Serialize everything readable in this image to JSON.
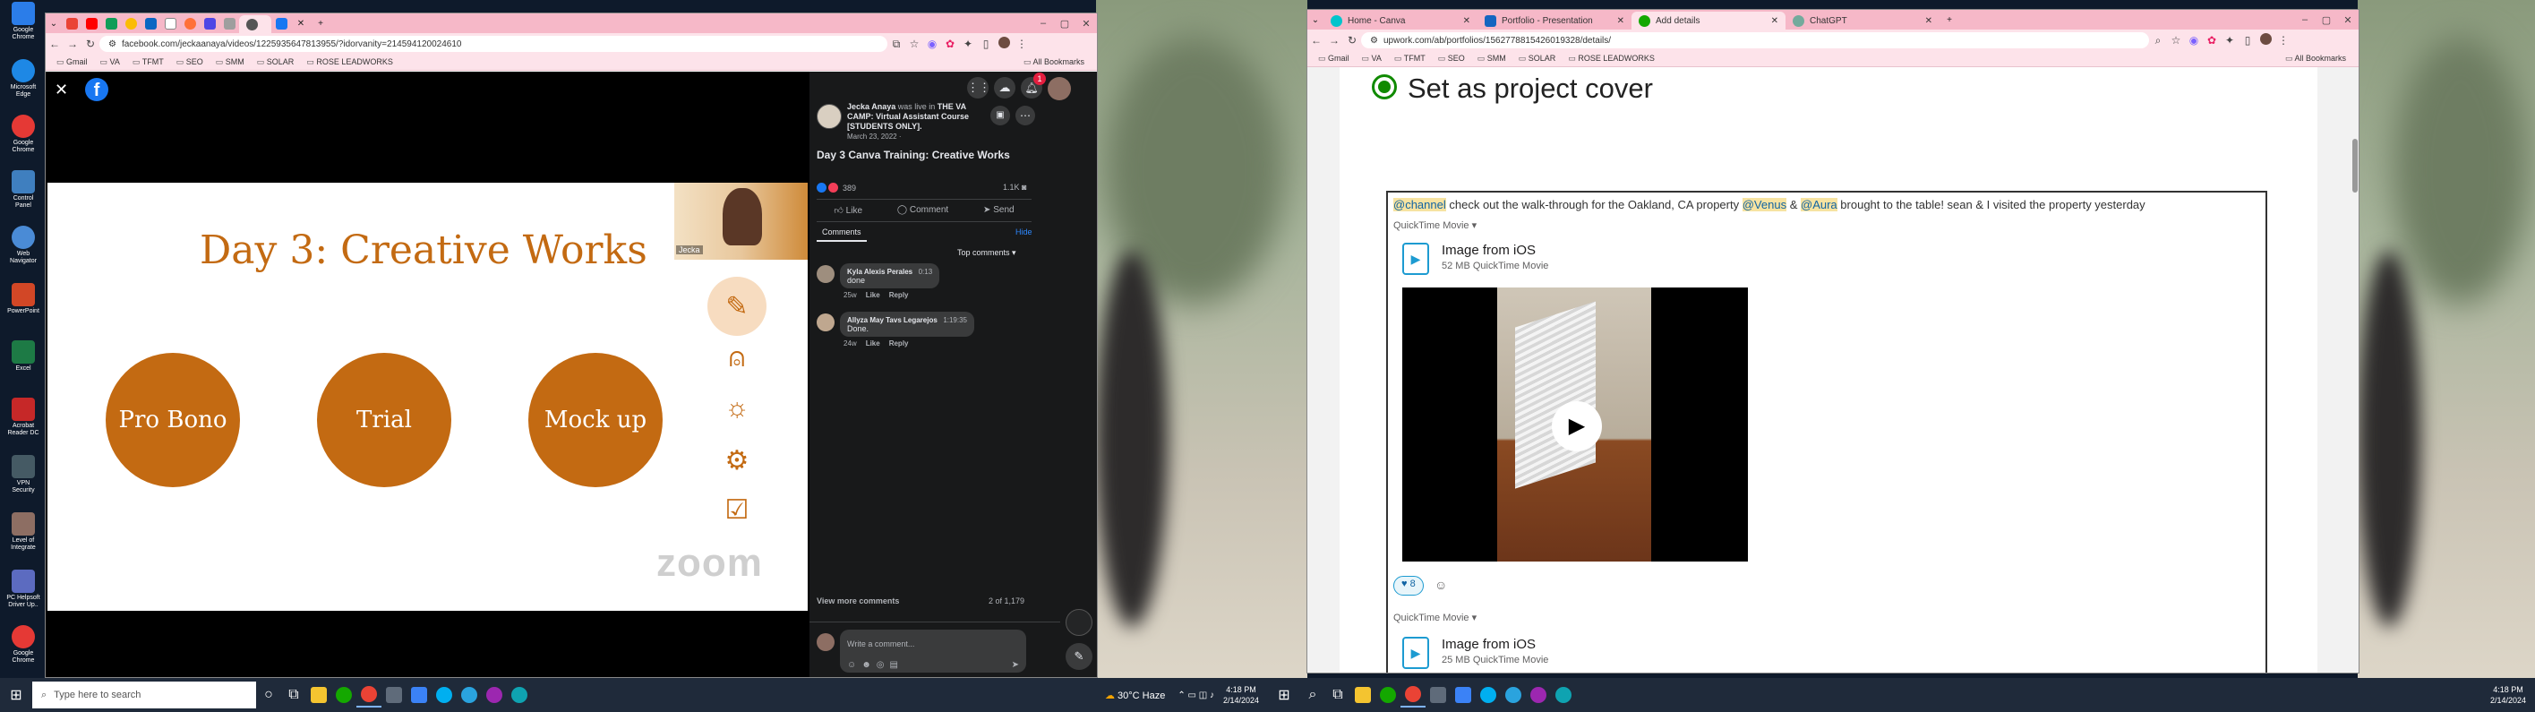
{
  "left_browser": {
    "tabs": [
      "Gmail",
      "YouTube",
      "Sheets",
      "Chrome",
      "LinkedIn",
      "Page",
      "Firefox",
      "Flipboard",
      "Tab",
      "Sound",
      "Facebook"
    ],
    "url": "facebook.com/jeckaanaya/videos/1225935647813955/?idorvanity=214594120024610",
    "bookmarks": [
      "Gmail",
      "VA",
      "TFMT",
      "SEO",
      "SMM",
      "SOLAR",
      "ROSE LEADWORKS"
    ],
    "all_bookmarks": "All Bookmarks"
  },
  "slide": {
    "title": "Day 3: Creative Works",
    "circles": [
      "Pro Bono",
      "Trial",
      "Mock up"
    ],
    "watermark": "zoom",
    "presenter_label": "Jecka"
  },
  "post": {
    "author": "Jecka Anaya",
    "live_text": "was live in",
    "group": "THE VA CAMP: Virtual Assistant Course [STUDENTS ONLY].",
    "date": "March 23, 2022 ·",
    "title": "Day 3 Canva Training: Creative Works",
    "reactions": "389",
    "views": "1.1K",
    "actions": [
      "Like",
      "Comment",
      "Send"
    ],
    "tab_comments": "Comments",
    "hide": "Hide",
    "sort": "Top comments",
    "comments": [
      {
        "name": "Kyla Alexis Perales",
        "time": "0:13",
        "text": "done",
        "age": "25w",
        "like": "Like",
        "reply": "Reply"
      },
      {
        "name": "Allyza May Tavs Legarejos",
        "time": "1:19:35",
        "text": "Done.",
        "age": "24w",
        "like": "Like",
        "reply": "Reply"
      }
    ],
    "view_more": "View more comments",
    "count": "2 of 1,179",
    "write_placeholder": "Write a comment...",
    "notif_badge": "1"
  },
  "right_browser": {
    "tabs": [
      {
        "label": "Home - Canva",
        "active": false
      },
      {
        "label": "Portfolio - Presentation",
        "active": false
      },
      {
        "label": "Add details",
        "active": true
      },
      {
        "label": "ChatGPT",
        "active": false
      }
    ],
    "url": "upwork.com/ab/portfolios/1562778815426019328/details/",
    "bookmarks": [
      "Gmail",
      "VA",
      "TFMT",
      "SEO",
      "SMM",
      "SOLAR",
      "ROSE LEADWORKS"
    ],
    "all_bookmarks": "All Bookmarks"
  },
  "upwork": {
    "cover_label": "Set as project cover",
    "message_mention": "@channel",
    "message_text_1": "check out the walk-through for the Oakland, CA property",
    "mention2": "@Venus",
    "amp": "&",
    "mention3": "@Aura",
    "message_text_2": "brought to the table! sean & I visited the property yesterday",
    "attach1_type": "QuickTime Movie",
    "file1_name": "Image from iOS",
    "file1_meta": "52 MB QuickTime Movie",
    "reaction_count": "8",
    "attach2_type": "QuickTime Movie",
    "file2_name": "Image from iOS",
    "file2_meta": "25 MB QuickTime Movie"
  },
  "taskbar_left": {
    "search_placeholder": "Type here to search",
    "weather": "30°C  Haze",
    "time": "4:18 PM",
    "date": "2/14/2024"
  },
  "taskbar_right": {
    "time": "4:18 PM",
    "date": "2/14/2024"
  },
  "desktop_icons": [
    "Google Chrome",
    "Microsoft Edge",
    "Google Chrome",
    "Control Panel",
    "Web Navigator",
    "PowerPoint",
    "Excel",
    "Acrobat Reader DC",
    "VPN Security",
    "Level of Integrate",
    "PC Helpsoft Driver Up..",
    "Google Chrome"
  ],
  "colors": {
    "accent": "#c36a12",
    "fb_blue": "#1877f2",
    "tab_pink": "#f6b8c8"
  }
}
